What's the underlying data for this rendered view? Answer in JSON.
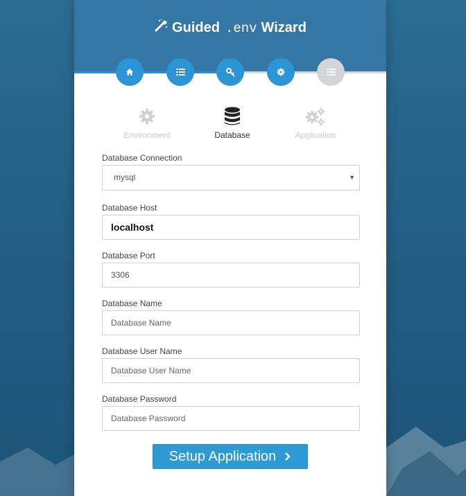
{
  "header": {
    "title_prefix": "Guided",
    "title_code": ".env",
    "title_suffix": "Wizard",
    "icon": "magic-wand-icon"
  },
  "steps": [
    {
      "icon": "home-icon",
      "state": "complete"
    },
    {
      "icon": "list-icon",
      "state": "complete"
    },
    {
      "icon": "key-icon",
      "state": "complete"
    },
    {
      "icon": "gear-icon",
      "state": "complete"
    },
    {
      "icon": "list-icon",
      "state": "inactive"
    }
  ],
  "tabs": [
    {
      "label": "Environment",
      "icon": "gear-icon",
      "active": false
    },
    {
      "label": "Database",
      "icon": "database-icon",
      "active": true
    },
    {
      "label": "Application",
      "icon": "gears-icon",
      "active": false
    }
  ],
  "form": {
    "connection": {
      "label": "Database Connection",
      "value": "mysql"
    },
    "host": {
      "label": "Database Host",
      "value": "localhost"
    },
    "port": {
      "label": "Database Port",
      "value": "3306"
    },
    "name": {
      "label": "Database Name",
      "placeholder": "Database Name"
    },
    "username": {
      "label": "Database User Name",
      "placeholder": "Database User Name"
    },
    "password": {
      "label": "Database Password",
      "placeholder": "Database Password"
    }
  },
  "button": {
    "label": "Setup Application",
    "icon": "chevron-right-icon"
  },
  "colors": {
    "accent": "#2b95d6",
    "header": "#3477a4",
    "background": "#245f84",
    "inactive": "#d3d5d8"
  }
}
